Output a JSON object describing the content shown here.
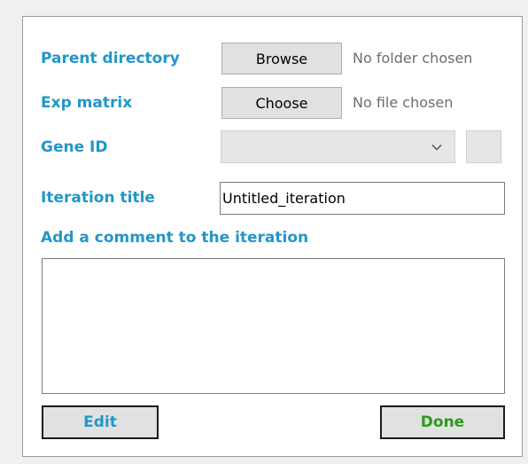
{
  "form": {
    "parent_directory": {
      "label": "Parent directory",
      "button_label": "Browse",
      "status": "No folder chosen"
    },
    "exp_matrix": {
      "label": "Exp matrix",
      "button_label": "Choose",
      "status": "No file chosen"
    },
    "gene_id": {
      "label": "Gene ID",
      "selected_value": ""
    },
    "iteration_title": {
      "label": "Iteration title",
      "value": "Untitled_iteration"
    },
    "comment": {
      "label": "Add a comment to the iteration",
      "value": ""
    },
    "actions": {
      "edit_label": "Edit",
      "done_label": "Done"
    }
  },
  "colors": {
    "label": "#2496c8",
    "done": "#2c9a1e",
    "panel_border": "#9a9a9a"
  },
  "icons": {
    "dropdown": "chevron-down-icon"
  }
}
